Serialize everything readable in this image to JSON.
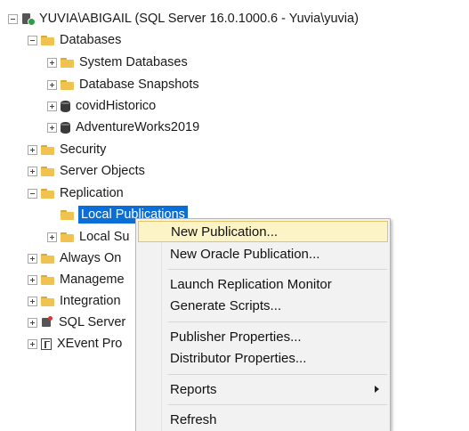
{
  "tree": {
    "server": "YUVIA\\ABIGAIL (SQL Server 16.0.1000.6 - Yuvia\\yuvia)",
    "databases": "Databases",
    "system_databases": "System Databases",
    "database_snapshots": "Database Snapshots",
    "covid_historico": "covidHistorico",
    "adventureworks": "AdventureWorks2019",
    "security": "Security",
    "server_objects": "Server Objects",
    "replication": "Replication",
    "local_publications": "Local Publications",
    "local_subscriptions": "Local Su",
    "always_on": "Always On",
    "management": "Manageme",
    "integration": "Integration",
    "sql_server_agent": "SQL Server",
    "xevent": "XEvent Pro"
  },
  "menu": {
    "new_publication": "New Publication...",
    "new_oracle_publication": "New Oracle Publication...",
    "launch_replication_monitor": "Launch Replication Monitor",
    "generate_scripts": "Generate Scripts...",
    "publisher_properties": "Publisher Properties...",
    "distributor_properties": "Distributor Properties...",
    "reports": "Reports",
    "refresh": "Refresh"
  },
  "colors": {
    "selection": "#0a6ed6",
    "menu_highlight": "#fcf4c6",
    "menu_highlight_border": "#e5c365",
    "folder": "#f0c350",
    "server_status": "#2e9e44"
  }
}
